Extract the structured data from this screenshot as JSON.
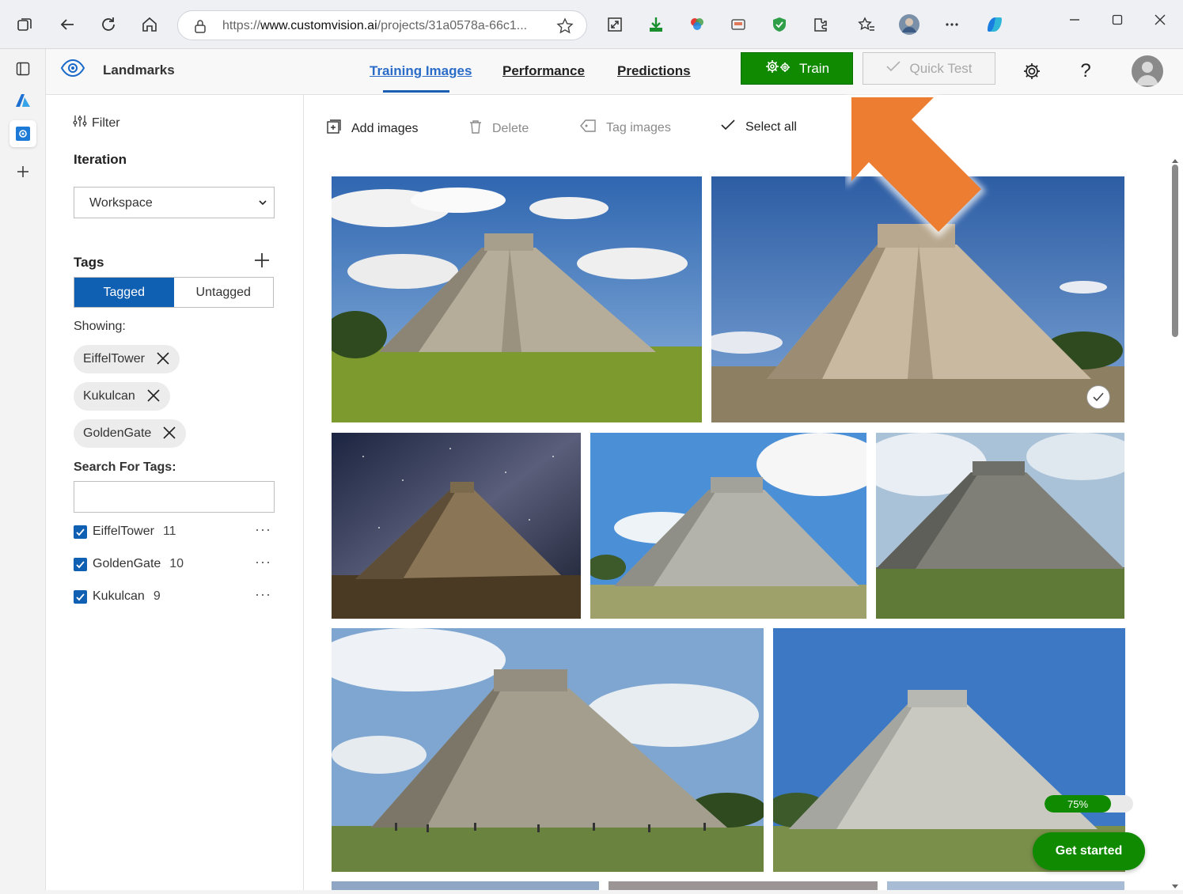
{
  "browser": {
    "url_scheme": "https://",
    "url_host": "www.customvision.ai",
    "url_path": "/projects/31a0578a-66c1..."
  },
  "app": {
    "title": "Landmarks",
    "nav": [
      {
        "label": "Training Images",
        "active": true
      },
      {
        "label": "Performance",
        "active": false
      },
      {
        "label": "Predictions",
        "active": false
      }
    ],
    "train_label": "Train",
    "quick_test_label": "Quick Test",
    "help_label": "?"
  },
  "sidebar": {
    "filter_label": "Filter",
    "iteration_title": "Iteration",
    "iteration_value": "Workspace",
    "tags_title": "Tags",
    "toggle": {
      "tagged": "Tagged",
      "untagged": "Untagged"
    },
    "showing_label": "Showing:",
    "chips": [
      "EiffelTower",
      "Kukulcan",
      "GoldenGate"
    ],
    "search_label": "Search For Tags:",
    "search_value": "",
    "tag_list": [
      {
        "name": "EiffelTower",
        "count": "11",
        "checked": true
      },
      {
        "name": "GoldenGate",
        "count": "10",
        "checked": true
      },
      {
        "name": "Kukulcan",
        "count": "9",
        "checked": true
      }
    ]
  },
  "toolbar": {
    "add_images": "Add images",
    "delete": "Delete",
    "tag_images": "Tag images",
    "select_all": "Select all"
  },
  "progress": {
    "value": 0.75,
    "label": "75%"
  },
  "get_started_label": "Get started",
  "colors": {
    "accent_blue": "#0f5fb3",
    "train_green": "#108a00",
    "arrow_orange": "#ed7d31"
  }
}
